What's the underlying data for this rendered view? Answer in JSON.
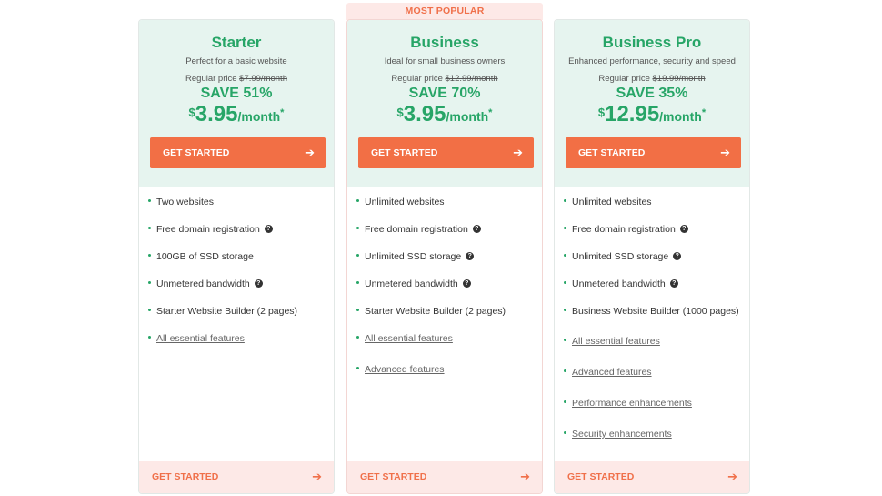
{
  "banner": {
    "label": "MOST POPULAR"
  },
  "plans": [
    {
      "name": "Starter",
      "tagline": "Perfect for a basic website",
      "regular_prefix": "Regular price ",
      "regular_price": "$7.99/month",
      "save": "SAVE 51%",
      "currency": "$",
      "price": "3.95",
      "per": "/month",
      "star": "*",
      "cta": "GET STARTED",
      "features": [
        "Two websites",
        "Free domain registration",
        "100GB of SSD storage",
        "Unmetered bandwidth",
        "Starter Website Builder (2 pages)"
      ],
      "links": [
        "All essential features"
      ],
      "bottom_cta": "GET STARTED"
    },
    {
      "name": "Business",
      "tagline": "Ideal for small business owners",
      "regular_prefix": "Regular price ",
      "regular_price": "$12.99/month",
      "save": "SAVE 70%",
      "currency": "$",
      "price": "3.95",
      "per": "/month",
      "star": "*",
      "cta": "GET STARTED",
      "features": [
        "Unlimited websites",
        "Free domain registration",
        "Unlimited SSD storage",
        "Unmetered bandwidth",
        "Starter Website Builder (2 pages)"
      ],
      "links": [
        "All essential features",
        "Advanced features"
      ],
      "bottom_cta": "GET STARTED"
    },
    {
      "name": "Business Pro",
      "tagline": "Enhanced performance, security and speed",
      "regular_prefix": "Regular price ",
      "regular_price": "$19.99/month",
      "save": "SAVE 35%",
      "currency": "$",
      "price": "12.95",
      "per": "/month",
      "star": "*",
      "cta": "GET STARTED",
      "features": [
        "Unlimited websites",
        "Free domain registration",
        "Unlimited SSD storage",
        "Unmetered bandwidth",
        "Business Website Builder (1000 pages)"
      ],
      "links": [
        "All essential features",
        "Advanced features",
        "Performance enhancements",
        "Security enhancements"
      ],
      "bottom_cta": "GET STARTED"
    }
  ],
  "icons": {
    "arrow": "arrow-right-icon",
    "help": "question-circle-icon"
  },
  "colors": {
    "brand_green": "#27a567",
    "cta_orange": "#f26f45",
    "header_bg": "#e6f4ef",
    "popular_bg": "#fde9e7"
  }
}
